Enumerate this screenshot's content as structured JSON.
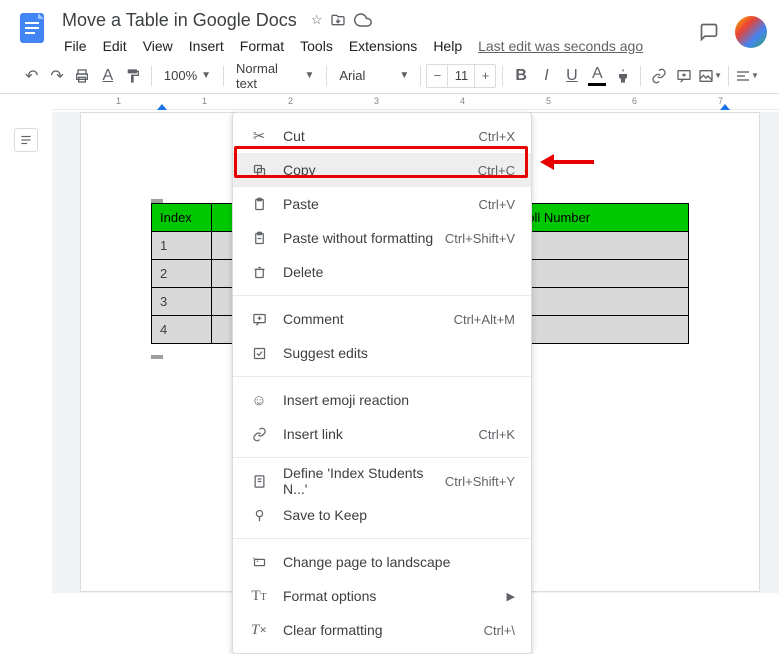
{
  "header": {
    "doc_title": "Move a Table in Google Docs",
    "last_edit": "Last edit was seconds ago",
    "menu": [
      "File",
      "Edit",
      "View",
      "Insert",
      "Format",
      "Tools",
      "Extensions",
      "Help"
    ]
  },
  "toolbar": {
    "zoom": "100%",
    "style": "Normal text",
    "font": "Arial",
    "font_size": "11"
  },
  "ruler": {
    "marks": [
      {
        "pos": 14,
        "label": ""
      },
      {
        "pos": 64,
        "label": "1"
      },
      {
        "pos": 150,
        "label": "1"
      },
      {
        "pos": 236,
        "label": "2"
      },
      {
        "pos": 322,
        "label": "3"
      },
      {
        "pos": 408,
        "label": "4"
      },
      {
        "pos": 494,
        "label": "5"
      },
      {
        "pos": 580,
        "label": "6"
      },
      {
        "pos": 666,
        "label": "7"
      }
    ]
  },
  "table": {
    "headers": [
      "Index",
      "",
      "Roll Number"
    ],
    "rows": [
      [
        "1",
        "",
        ""
      ],
      [
        "2",
        "",
        ""
      ],
      [
        "3",
        "",
        ""
      ],
      [
        "4",
        "",
        ""
      ]
    ]
  },
  "context_menu": {
    "groups": [
      [
        {
          "icon": "cut",
          "label": "Cut",
          "shortcut": "Ctrl+X"
        },
        {
          "icon": "copy",
          "label": "Copy",
          "shortcut": "Ctrl+C",
          "highlighted": true
        },
        {
          "icon": "paste",
          "label": "Paste",
          "shortcut": "Ctrl+V"
        },
        {
          "icon": "paste-plain",
          "label": "Paste without formatting",
          "shortcut": "Ctrl+Shift+V"
        },
        {
          "icon": "delete",
          "label": "Delete",
          "shortcut": ""
        }
      ],
      [
        {
          "icon": "comment",
          "label": "Comment",
          "shortcut": "Ctrl+Alt+M"
        },
        {
          "icon": "suggest",
          "label": "Suggest edits",
          "shortcut": ""
        }
      ],
      [
        {
          "icon": "emoji",
          "label": "Insert emoji reaction",
          "shortcut": ""
        },
        {
          "icon": "link",
          "label": "Insert link",
          "shortcut": "Ctrl+K"
        }
      ],
      [
        {
          "icon": "define",
          "label": "Define 'Index Students N...'",
          "shortcut": "Ctrl+Shift+Y"
        },
        {
          "icon": "keep",
          "label": "Save to Keep",
          "shortcut": ""
        }
      ],
      [
        {
          "icon": "landscape",
          "label": "Change page to landscape",
          "shortcut": ""
        },
        {
          "icon": "format-options",
          "label": "Format options",
          "shortcut": "",
          "submenu": true
        },
        {
          "icon": "clear-format",
          "label": "Clear formatting",
          "shortcut": "Ctrl+\\"
        }
      ]
    ]
  }
}
